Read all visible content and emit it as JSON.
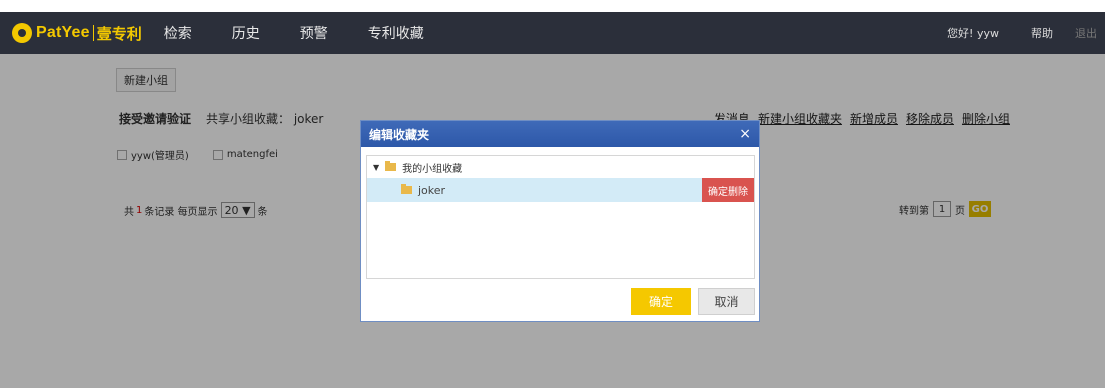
{
  "header": {
    "logo_text": "Pat",
    "logo_text2": "Yee",
    "logo_cn": "壹专利",
    "nav": [
      "检索",
      "历史",
      "预警",
      "专利收藏"
    ],
    "greeting": "您好! yyw",
    "help": "帮助",
    "logout": "退出"
  },
  "page": {
    "new_group_button": "新建小组",
    "accept_invite": "接受邀请验证",
    "share_label": "共享小组收藏：",
    "share_value": "joker",
    "actions": [
      "发消息",
      "新建小组收藏夹",
      "新增成员",
      "移除成员",
      "删除小组"
    ],
    "members": [
      "yyw(管理员)",
      "matengfei"
    ],
    "pager": {
      "total_prefix": "共",
      "total_count": "1",
      "total_suffix": "条记录",
      "per_page_prefix": "每页显示",
      "per_page_value": "20",
      "per_page_suffix": "条",
      "goto_prefix": "转到第",
      "goto_page": "1",
      "goto_suffix": "页",
      "go": "GO"
    }
  },
  "modal": {
    "title": "编辑收藏夹",
    "close": "×",
    "root": "我的小组收藏",
    "child": "joker",
    "delete_button": "确定删除",
    "ok": "确定",
    "cancel": "取消"
  },
  "colors": {
    "topbar": "#2b2f3a",
    "brand": "#f3c800",
    "modal_header": "#2d58a9",
    "danger": "#d9534f",
    "selected_row": "#d3ebf7"
  }
}
